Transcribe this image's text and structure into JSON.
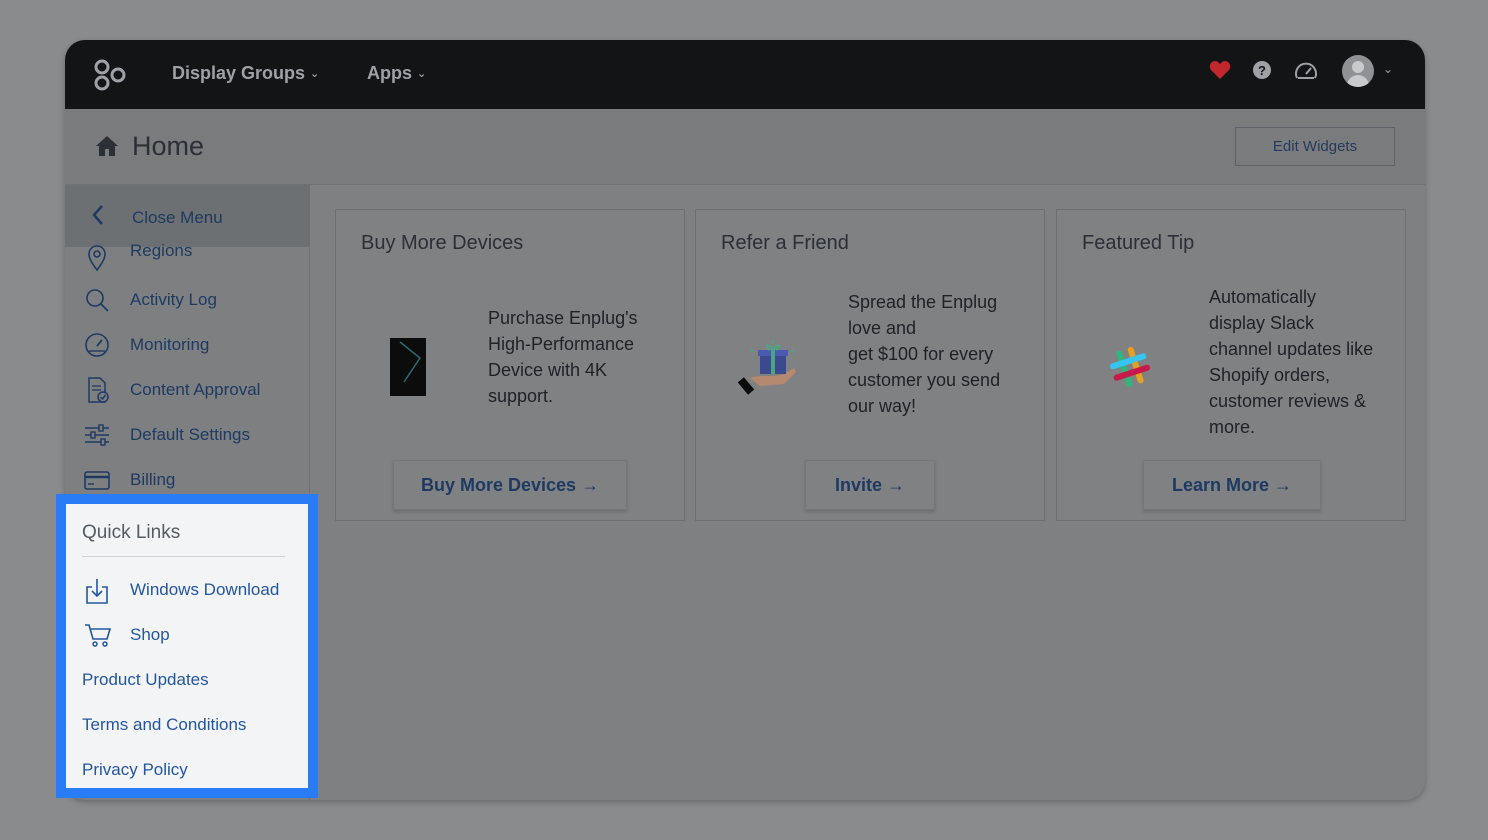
{
  "colors": {
    "accent_link": "#23569e",
    "highlight_border": "#2a7cf6",
    "topbar": "#131416",
    "heart": "#c1272d"
  },
  "topnav": {
    "items": [
      {
        "label": "Display Groups",
        "icon": "chevron-down-icon"
      },
      {
        "label": "Apps",
        "icon": "chevron-down-icon"
      }
    ],
    "right_icons": [
      "heart-icon",
      "help-icon",
      "dashboard-gauge-icon",
      "avatar",
      "chevron-down-icon"
    ]
  },
  "header": {
    "title": "Home",
    "edit_button": "Edit Widgets"
  },
  "sidebar": {
    "close_label": "Close Menu",
    "items": [
      {
        "label": "Regions",
        "icon": "map-pin-icon"
      },
      {
        "label": "Activity Log",
        "icon": "search-icon"
      },
      {
        "label": "Monitoring",
        "icon": "gauge-icon"
      },
      {
        "label": "Content Approval",
        "icon": "document-check-icon"
      },
      {
        "label": "Default Settings",
        "icon": "sliders-icon"
      },
      {
        "label": "Billing",
        "icon": "credit-card-icon"
      }
    ]
  },
  "quick_links": {
    "title": "Quick Links",
    "items": [
      {
        "label": "Windows Download",
        "icon": "download-icon"
      },
      {
        "label": "Shop",
        "icon": "cart-icon"
      },
      {
        "label": "Product Updates"
      },
      {
        "label": "Terms and Conditions"
      },
      {
        "label": "Privacy Policy"
      }
    ]
  },
  "cards": [
    {
      "title": "Buy More Devices",
      "lines": [
        "Purchase Enplug's",
        "High-Performance",
        "Device with 4K",
        "support."
      ],
      "button": "Buy More Devices →",
      "icon": "device-icon"
    },
    {
      "title": "Refer a Friend",
      "lines": [
        "Spread the Enplug",
        "love and",
        "get $100 for every",
        "customer you send",
        "our way!"
      ],
      "button": "Invite →",
      "icon": "gift-icon"
    },
    {
      "title": "Featured Tip",
      "lines": [
        "Automatically",
        "display Slack",
        "channel updates like",
        "Shopify orders,",
        "customer reviews &",
        "more."
      ],
      "button": "Learn More →",
      "icon": "slack-icon"
    }
  ]
}
